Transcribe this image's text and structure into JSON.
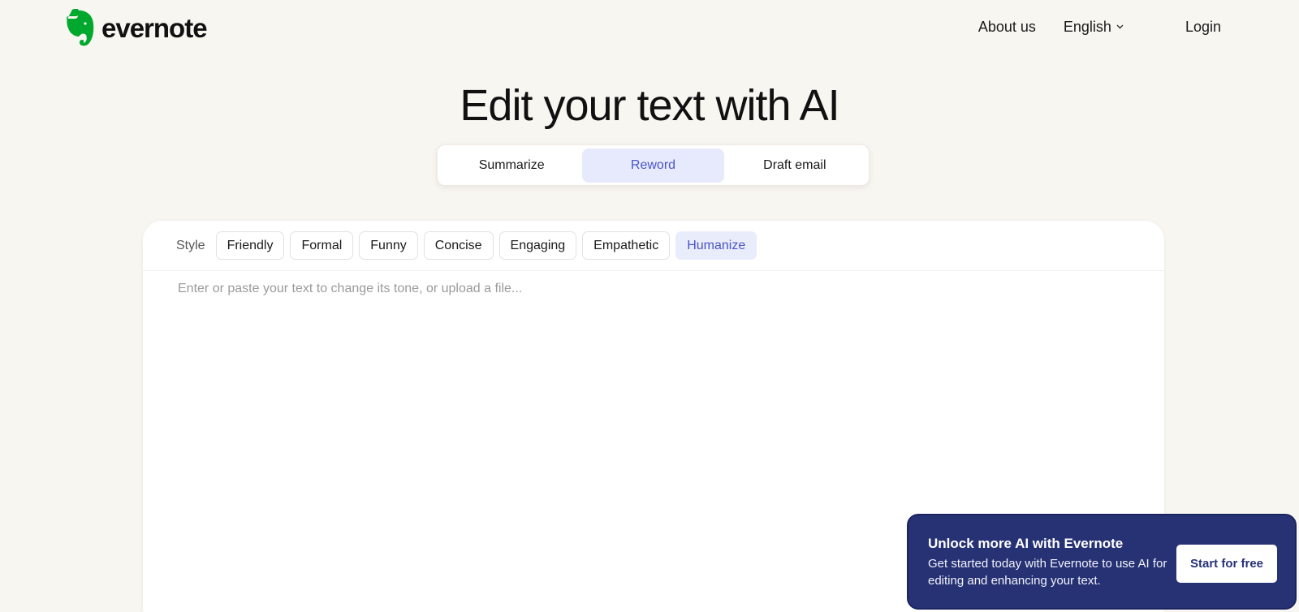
{
  "header": {
    "logo_text": "evernote",
    "logo_icon": "elephant-icon",
    "brand_color": "#00a82d",
    "nav": {
      "about": "About us",
      "language": "English",
      "language_icon": "chevron-down-icon",
      "login": "Login"
    }
  },
  "main": {
    "title": "Edit your text with AI",
    "tabs": [
      {
        "label": "Summarize",
        "active": false
      },
      {
        "label": "Reword",
        "active": true
      },
      {
        "label": "Draft email",
        "active": false
      }
    ],
    "accent_color": "#4a55c9"
  },
  "editor": {
    "style_label": "Style",
    "styles": [
      {
        "label": "Friendly",
        "active": false
      },
      {
        "label": "Formal",
        "active": false
      },
      {
        "label": "Funny",
        "active": false
      },
      {
        "label": "Concise",
        "active": false
      },
      {
        "label": "Engaging",
        "active": false
      },
      {
        "label": "Empathetic",
        "active": false
      },
      {
        "label": "Humanize",
        "active": true
      }
    ],
    "placeholder": "Enter or paste your text to change its tone, or upload a file...",
    "value": ""
  },
  "promo": {
    "title": "Unlock more AI with Evernote",
    "body": "Get started today with Evernote to use AI for editing and enhancing your text.",
    "button": "Start for free",
    "background_color": "#273275"
  }
}
